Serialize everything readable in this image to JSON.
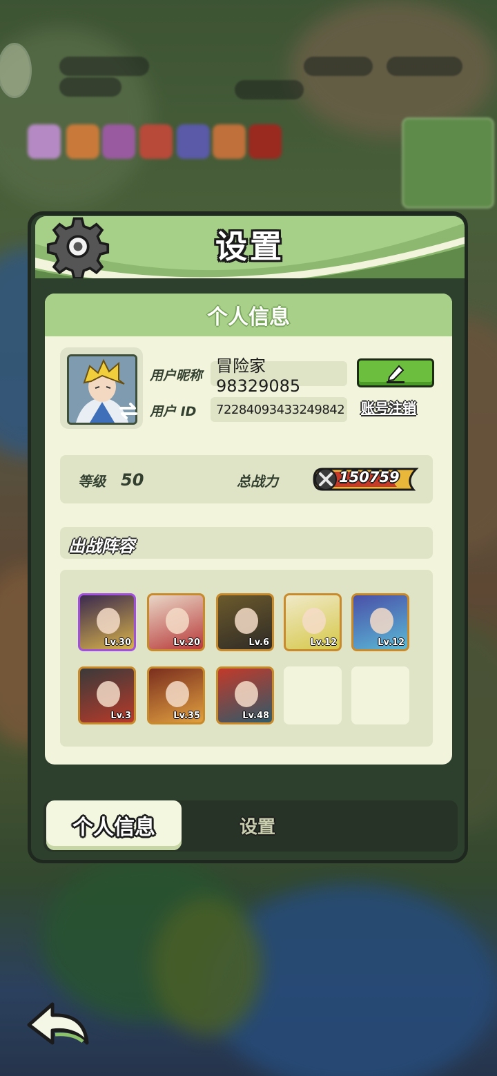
{
  "panel": {
    "title": "设置"
  },
  "profile": {
    "section_title": "个人信息",
    "nickname_label": "用户昵称",
    "nickname": "冒险家98329085",
    "id_label": "用户 ID",
    "user_id": "72284093433249842",
    "cancel_account": "账号注销",
    "level_label": "等级",
    "level": "50",
    "power_label": "总战力",
    "power": "150759"
  },
  "lineup": {
    "title": "出战阵容",
    "heroes": [
      {
        "lv": "Lv.30",
        "rarity": "purple",
        "colors": [
          "#3b2a4e",
          "#d8b24a"
        ]
      },
      {
        "lv": "Lv.20",
        "rarity": "gold",
        "colors": [
          "#e9d6c6",
          "#b83a3a"
        ]
      },
      {
        "lv": "Lv.6",
        "rarity": "gold",
        "colors": [
          "#6c5a2c",
          "#2f2b26"
        ]
      },
      {
        "lv": "Lv.12",
        "rarity": "gold",
        "colors": [
          "#f0e9c8",
          "#d6c84a"
        ]
      },
      {
        "lv": "Lv.12",
        "rarity": "gold",
        "colors": [
          "#4a4fa8",
          "#5ab9d6"
        ]
      },
      {
        "lv": "Lv.3",
        "rarity": "gold",
        "colors": [
          "#3a3a3a",
          "#b83a2a"
        ]
      },
      {
        "lv": "Lv.35",
        "rarity": "gold",
        "colors": [
          "#7a2e1e",
          "#e0a040"
        ]
      },
      {
        "lv": "Lv.48",
        "rarity": "gold",
        "colors": [
          "#c23a2a",
          "#2f5a6a"
        ]
      },
      {
        "lv": "",
        "rarity": "empty"
      },
      {
        "lv": "",
        "rarity": "empty"
      }
    ]
  },
  "tabs": {
    "active": "个人信息",
    "inactive": "设置"
  },
  "icons": [
    "gear-icon",
    "swap-icon",
    "edit-pencil-icon",
    "crossed-swords-icon",
    "back-arrow-icon"
  ]
}
